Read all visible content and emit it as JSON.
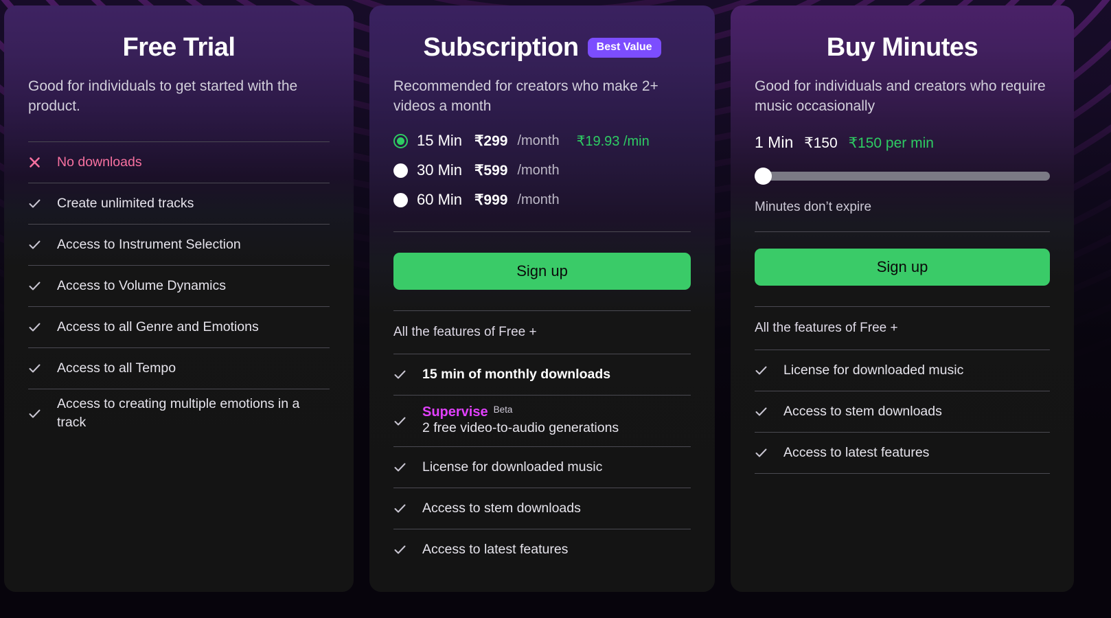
{
  "theme": {
    "accent_green": "#3acb68",
    "accent_purple": "#7c4dff",
    "accent_pink": "#f871a0",
    "accent_magenta": "#e040fb",
    "card_top": "#3e2362",
    "card_bottom": "#141414"
  },
  "plans": [
    {
      "id": "free-trial",
      "title": "Free Trial",
      "description": "Good for individuals to get started with the product.",
      "features": [
        {
          "icon": "cross-icon",
          "label": "No downloads",
          "negative": true
        },
        {
          "icon": "check-icon",
          "label": "Create unlimited tracks",
          "negative": false
        },
        {
          "icon": "check-icon",
          "label": "Access to Instrument Selection",
          "negative": false
        },
        {
          "icon": "check-icon",
          "label": "Access to Volume Dynamics",
          "negative": false
        },
        {
          "icon": "check-icon",
          "label": "Access to all Genre and Emotions",
          "negative": false
        },
        {
          "icon": "check-icon",
          "label": "Access to all Tempo",
          "negative": false
        },
        {
          "icon": "check-icon",
          "label": "Access to creating multiple emotions in a track",
          "negative": false
        }
      ]
    },
    {
      "id": "subscription",
      "title": "Subscription",
      "badge": "Best Value",
      "description": "Recommended for creators who make 2+ videos a month",
      "options": [
        {
          "minutes": "15 Min",
          "price": "₹299",
          "period": "/month",
          "rate": "₹19.93 /min",
          "selected": true
        },
        {
          "minutes": "30 Min",
          "price": "₹599",
          "period": "/month",
          "rate": "",
          "selected": false
        },
        {
          "minutes": "60 Min",
          "price": "₹999",
          "period": "/month",
          "rate": "",
          "selected": false
        }
      ],
      "cta": "Sign up",
      "includes_note": "All the features of Free +",
      "features": [
        {
          "icon": "check-icon",
          "label": "15 min of monthly downloads",
          "bold": true
        },
        {
          "icon": "check-icon",
          "type": "supervise",
          "name": "Supervise",
          "tag": "Beta",
          "label": "2 free video-to-audio generations"
        },
        {
          "icon": "check-icon",
          "label": "License for downloaded music"
        },
        {
          "icon": "check-icon",
          "label": "Access to stem downloads"
        },
        {
          "icon": "check-icon",
          "label": "Access to latest features"
        }
      ]
    },
    {
      "id": "buy-minutes",
      "title": "Buy Minutes",
      "description": "Good for individuals and creators who require music occasionally",
      "selection": {
        "minutes": "1 Min",
        "price": "₹150",
        "rate": "₹150 per min",
        "slider_percent": 0
      },
      "note": "Minutes don’t expire",
      "cta": "Sign up",
      "includes_note": "All the features of Free +",
      "features": [
        {
          "icon": "check-icon",
          "label": "License for downloaded music"
        },
        {
          "icon": "check-icon",
          "label": "Access to stem downloads"
        },
        {
          "icon": "check-icon",
          "label": "Access to latest features"
        }
      ]
    }
  ]
}
